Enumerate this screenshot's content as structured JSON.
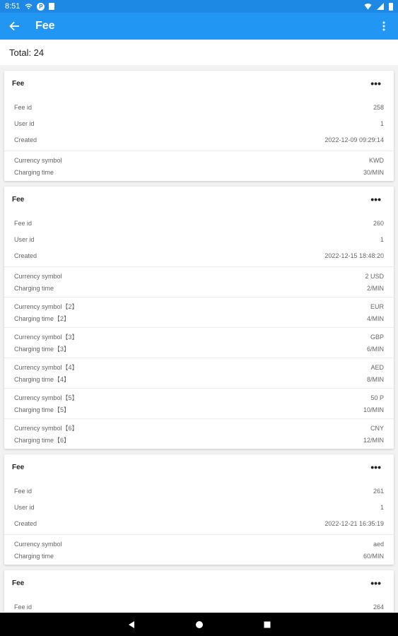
{
  "status": {
    "time": "8:51",
    "p_badge": "P"
  },
  "appbar": {
    "title": "Fee"
  },
  "total_label": "Total: 24",
  "cards": [
    {
      "header": "Fee",
      "top": [
        {
          "label": "Fee id",
          "value": "258"
        },
        {
          "label": "User id",
          "value": "1"
        },
        {
          "label": "Created",
          "value": "2022-12-09 09:29:14"
        }
      ],
      "groups": [
        [
          {
            "label": "Currency symbol",
            "value": "KWD"
          },
          {
            "label": "Charging time",
            "value": "30/MIN"
          }
        ]
      ]
    },
    {
      "header": "Fee",
      "top": [
        {
          "label": "Fee id",
          "value": "260"
        },
        {
          "label": "User id",
          "value": "1"
        },
        {
          "label": "Created",
          "value": "2022-12-15 18:48:20"
        }
      ],
      "groups": [
        [
          {
            "label": "Currency symbol",
            "value": "2 USD"
          },
          {
            "label": "Charging time",
            "value": "2/MIN"
          }
        ],
        [
          {
            "label": "Currency symbol【2】",
            "value": "EUR"
          },
          {
            "label": "Charging time【2】",
            "value": "4/MIN"
          }
        ],
        [
          {
            "label": "Currency symbol【3】",
            "value": "GBP"
          },
          {
            "label": "Charging time【3】",
            "value": "6/MIN"
          }
        ],
        [
          {
            "label": "Currency symbol【4】",
            "value": "AED"
          },
          {
            "label": "Charging time【4】",
            "value": "8/MIN"
          }
        ],
        [
          {
            "label": "Currency symbol【5】",
            "value": "50 P"
          },
          {
            "label": "Charging time【5】",
            "value": "10/MIN"
          }
        ],
        [
          {
            "label": "Currency symbol【6】",
            "value": "CNY"
          },
          {
            "label": "Charging time【6】",
            "value": "12/MIN"
          }
        ]
      ]
    },
    {
      "header": "Fee",
      "top": [
        {
          "label": "Fee id",
          "value": "261"
        },
        {
          "label": "User id",
          "value": "1"
        },
        {
          "label": "Created",
          "value": "2022-12-21 16:35:19"
        }
      ],
      "groups": [
        [
          {
            "label": "Currency symbol",
            "value": "aed"
          },
          {
            "label": "Charging time",
            "value": "60/MIN"
          }
        ]
      ]
    },
    {
      "header": "Fee",
      "top": [
        {
          "label": "Fee id",
          "value": "264"
        }
      ],
      "groups": []
    }
  ]
}
